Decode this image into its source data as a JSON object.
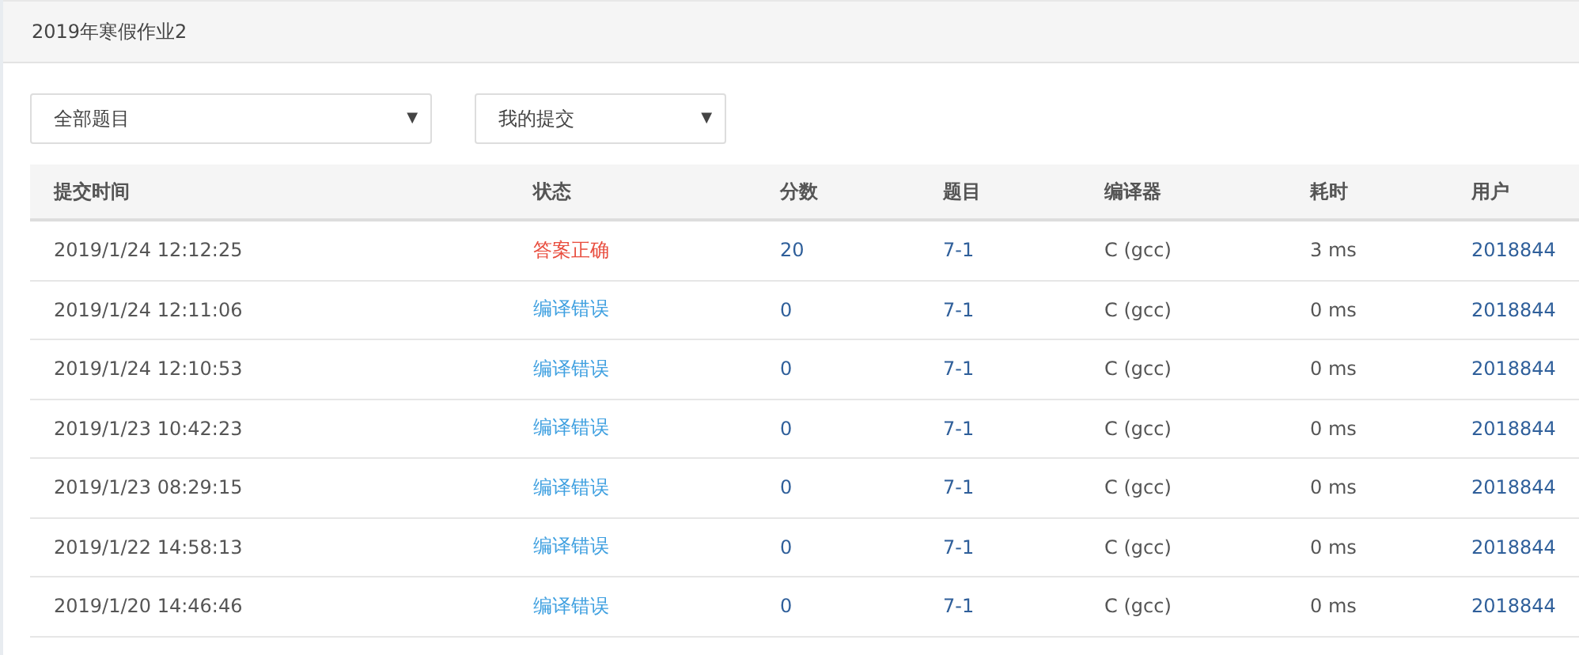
{
  "title": "2019年寒假作业2",
  "filters": [
    {
      "label": "全部题目",
      "icon": "▼"
    },
    {
      "label": "我的提交",
      "icon": "▼"
    }
  ],
  "table": {
    "columns": [
      "提交时间",
      "状态",
      "分数",
      "题目",
      "编译器",
      "耗时",
      "用户"
    ],
    "rows": [
      {
        "time": "2019/1/24 12:12:25",
        "status": "答案正确",
        "correct": true,
        "score": "20",
        "problem": "7-1",
        "compiler": "C (gcc)",
        "duration": "3 ms",
        "user": "2018844"
      },
      {
        "time": "2019/1/24 12:11:06",
        "status": "编译错误",
        "correct": false,
        "score": "0",
        "problem": "7-1",
        "compiler": "C (gcc)",
        "duration": "0 ms",
        "user": "2018844"
      },
      {
        "time": "2019/1/24 12:10:53",
        "status": "编译错误",
        "correct": false,
        "score": "0",
        "problem": "7-1",
        "compiler": "C (gcc)",
        "duration": "0 ms",
        "user": "2018844"
      },
      {
        "time": "2019/1/23 10:42:23",
        "status": "编译错误",
        "correct": false,
        "score": "0",
        "problem": "7-1",
        "compiler": "C (gcc)",
        "duration": "0 ms",
        "user": "2018844"
      },
      {
        "time": "2019/1/23 08:29:15",
        "status": "编译错误",
        "correct": false,
        "score": "0",
        "problem": "7-1",
        "compiler": "C (gcc)",
        "duration": "0 ms",
        "user": "2018844"
      },
      {
        "time": "2019/1/22 14:58:13",
        "status": "编译错误",
        "correct": false,
        "score": "0",
        "problem": "7-1",
        "compiler": "C (gcc)",
        "duration": "0 ms",
        "user": "2018844"
      },
      {
        "time": "2019/1/20 14:46:46",
        "status": "编译错误",
        "correct": false,
        "score": "0",
        "problem": "7-1",
        "compiler": "C (gcc)",
        "duration": "0 ms",
        "user": "2018844"
      }
    ]
  }
}
